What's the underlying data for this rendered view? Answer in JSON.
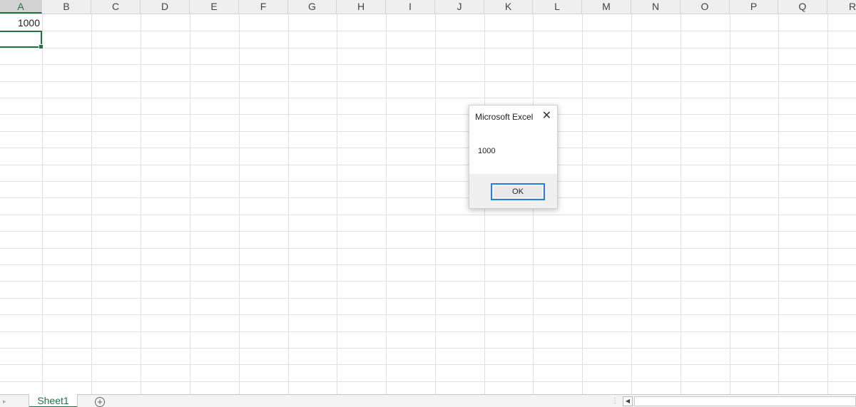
{
  "columns": [
    "A",
    "B",
    "C",
    "D",
    "E",
    "F",
    "G",
    "H",
    "I",
    "J",
    "K",
    "L",
    "M",
    "N",
    "O",
    "P",
    "Q",
    "R"
  ],
  "cells": {
    "A1": "1000"
  },
  "sheet": {
    "tab_label": "Sheet1",
    "add_symbol": "+"
  },
  "dialog": {
    "title": "Microsoft Excel",
    "close_symbol": "✕",
    "message": "1000",
    "ok_label": "OK"
  },
  "colors": {
    "accent": "#217346",
    "dialog_button_border": "#2a7fd4"
  },
  "icons": {
    "close": "close-icon",
    "add_sheet": "plus-circle-icon",
    "scroll_left": "triangle-left-icon"
  }
}
